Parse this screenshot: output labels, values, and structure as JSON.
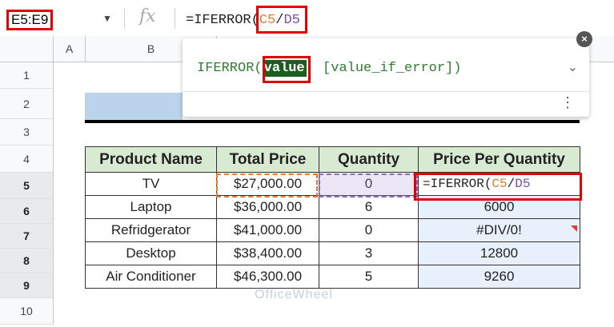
{
  "name_box": {
    "value": "E5:E9"
  },
  "formula_bar": {
    "fx": "fx",
    "prefix": "=IFERROR(",
    "ref_c": "C5",
    "slash": "/",
    "ref_d": "D5"
  },
  "columns": [
    "A",
    "B"
  ],
  "rows": [
    "1",
    "2",
    "3",
    "4",
    "5",
    "6",
    "7",
    "8",
    "9",
    "10"
  ],
  "tooltip": {
    "func": "IFERROR(",
    "arg_value": "value",
    "rest": ", [value_if_error])",
    "chevron": "⌄",
    "more": "⋮"
  },
  "close_label": "×",
  "table": {
    "headers": [
      "Product Name",
      "Total Price",
      "Quantity",
      "Price Per Quantity"
    ],
    "rows": [
      [
        "TV",
        "$27,000.00",
        "0",
        "=IFERROR(C5/D5"
      ],
      [
        "Laptop",
        "$36,000.00",
        "6",
        "6000"
      ],
      [
        "Refridgerator",
        "$41,000.00",
        "0",
        "#DIV/0!"
      ],
      [
        "Desktop",
        "$38,400.00",
        "3",
        "12800"
      ],
      [
        "Air Conditioner",
        "$46,300.00",
        "5",
        "9260"
      ]
    ],
    "formula_cell": {
      "prefix": "=IFERROR(",
      "ref_c": "C5",
      "slash": "/",
      "ref_d": "D5"
    }
  },
  "watermark": "OfficeWheel",
  "colors": {
    "highlight": "#e50000",
    "header_green": "#d9ead3",
    "selected_blue": "#e8f0fb",
    "ref_orange": "#e67c29",
    "ref_purple": "#7b4fa3"
  }
}
